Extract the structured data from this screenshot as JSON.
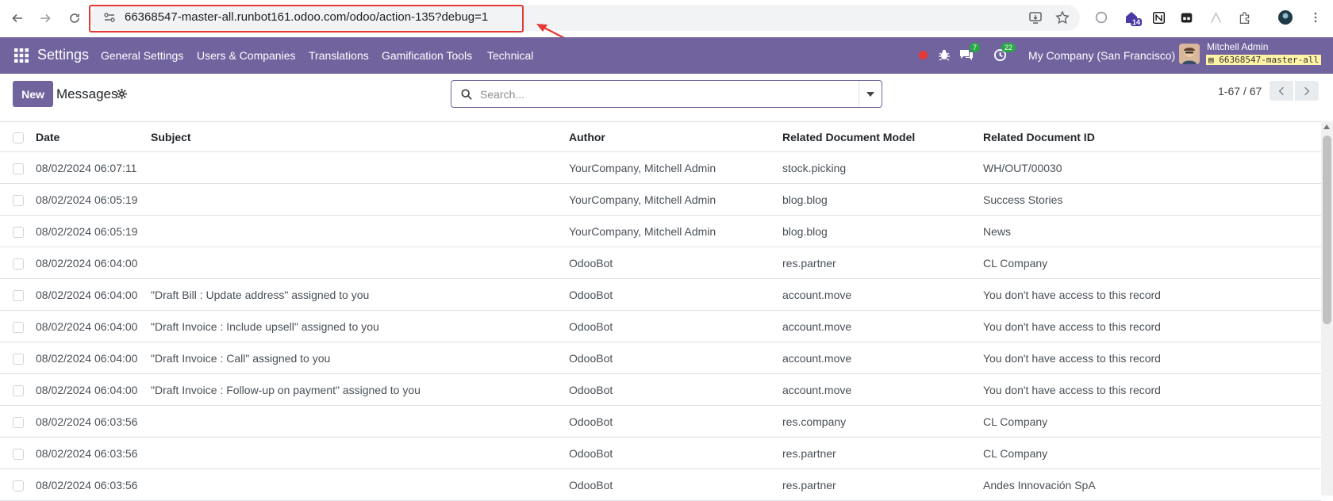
{
  "browser": {
    "url": "66368547-master-all.runbot161.odoo.com/odoo/action-135?debug=1",
    "ext_badge": "14"
  },
  "navbar": {
    "app_name": "Settings",
    "menu": [
      "General Settings",
      "Users & Companies",
      "Translations",
      "Gamification Tools",
      "Technical"
    ],
    "chat_count": "7",
    "activity_count": "22",
    "company": "My Company (San Francisco)",
    "user_name": "Mitchell Admin",
    "db_name": "66368547-master-all"
  },
  "control_panel": {
    "new_label": "New",
    "breadcrumb": "Messages",
    "search_placeholder": "Search...",
    "pager": "1-67 / 67"
  },
  "table": {
    "headers": [
      "Date",
      "Subject",
      "Author",
      "Related Document Model",
      "Related Document ID"
    ],
    "rows": [
      [
        "08/02/2024 06:07:11",
        "",
        "YourCompany, Mitchell Admin",
        "stock.picking",
        "WH/OUT/00030"
      ],
      [
        "08/02/2024 06:05:19",
        "",
        "YourCompany, Mitchell Admin",
        "blog.blog",
        "Success Stories"
      ],
      [
        "08/02/2024 06:05:19",
        "",
        "YourCompany, Mitchell Admin",
        "blog.blog",
        "News"
      ],
      [
        "08/02/2024 06:04:00",
        "",
        "OdooBot",
        "res.partner",
        "CL Company"
      ],
      [
        "08/02/2024 06:04:00",
        "\"Draft Bill : Update address\" assigned to you",
        "OdooBot",
        "account.move",
        "You don't have access to this record"
      ],
      [
        "08/02/2024 06:04:00",
        "\"Draft Invoice : Include upsell\" assigned to you",
        "OdooBot",
        "account.move",
        "You don't have access to this record"
      ],
      [
        "08/02/2024 06:04:00",
        "\"Draft Invoice : Call\" assigned to you",
        "OdooBot",
        "account.move",
        "You don't have access to this record"
      ],
      [
        "08/02/2024 06:04:00",
        "\"Draft Invoice : Follow-up on payment\" assigned to you",
        "OdooBot",
        "account.move",
        "You don't have access to this record"
      ],
      [
        "08/02/2024 06:03:56",
        "",
        "OdooBot",
        "res.company",
        "CL Company"
      ],
      [
        "08/02/2024 06:03:56",
        "",
        "OdooBot",
        "res.partner",
        "CL Company"
      ],
      [
        "08/02/2024 06:03:56",
        "",
        "OdooBot",
        "res.partner",
        "Andes Innovación SpA"
      ]
    ]
  },
  "colors": {
    "brand": "#71639e",
    "highlight_border": "#e53935",
    "badge": "#28a745"
  }
}
